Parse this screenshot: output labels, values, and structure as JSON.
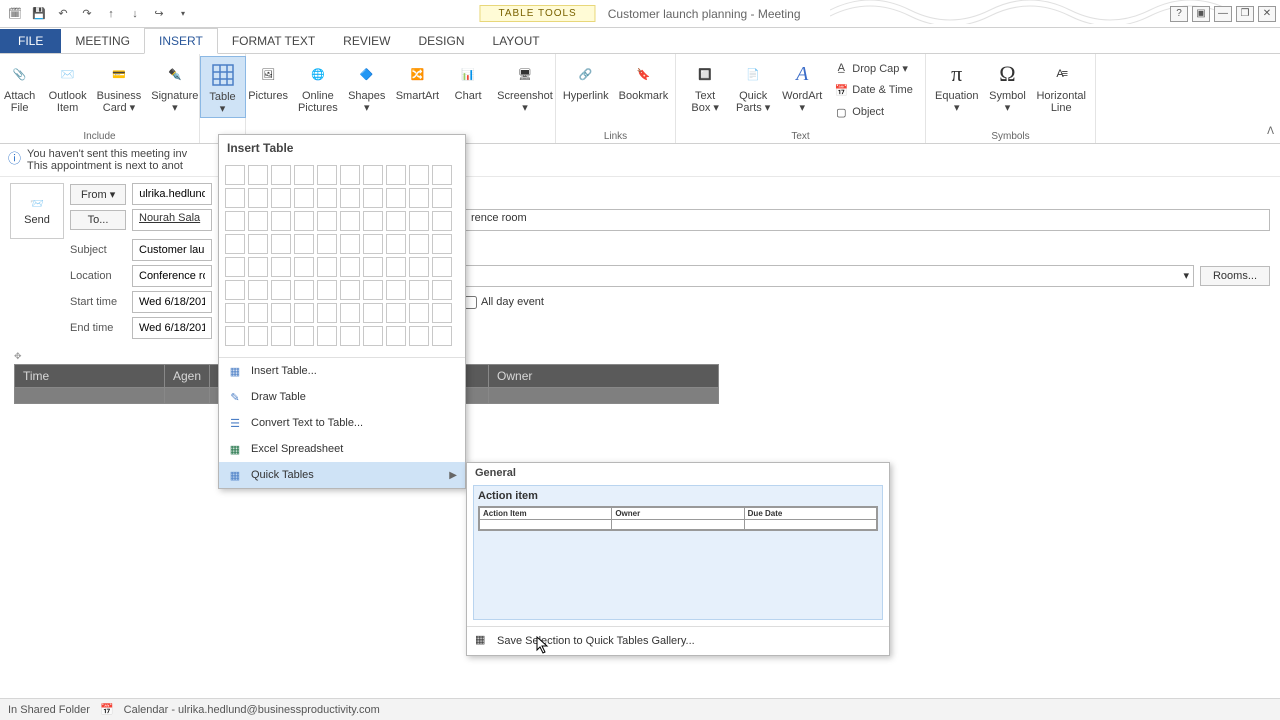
{
  "window": {
    "title": "Customer launch planning - Meeting",
    "table_tools": "TABLE TOOLS"
  },
  "qat": [
    "calendar-icon",
    "save-icon",
    "undo-icon",
    "redo-icon",
    "up-icon",
    "down-icon",
    "forward-icon"
  ],
  "win_controls": {
    "help": "?",
    "full": "▣",
    "min": "—",
    "restore": "❐",
    "close": "✕"
  },
  "tabs": {
    "file": "FILE",
    "list": [
      "MEETING",
      "INSERT",
      "FORMAT TEXT",
      "REVIEW",
      "DESIGN",
      "LAYOUT"
    ],
    "active": "INSERT"
  },
  "ribbon": {
    "groups": {
      "include": {
        "label": "Include",
        "items": [
          "Attach\nFile",
          "Outlook\nItem",
          "Business\nCard ▾",
          "Signature\n▾"
        ]
      },
      "tables": {
        "items": [
          "Table\n▾"
        ]
      },
      "illustrations": {
        "items": [
          "Pictures",
          "Online\nPictures",
          "Shapes\n▾",
          "SmartArt",
          "Chart",
          "Screenshot\n▾"
        ]
      },
      "links": {
        "label": "Links",
        "items": [
          "Hyperlink",
          "Bookmark"
        ]
      },
      "text": {
        "label": "Text",
        "items": [
          "Text\nBox ▾",
          "Quick\nParts ▾",
          "WordArt\n▾"
        ],
        "small": [
          "Drop Cap ▾",
          "Date & Time",
          "Object"
        ]
      },
      "symbols": {
        "label": "Symbols",
        "items": [
          "Equation\n▾",
          "Symbol\n▾",
          "Horizontal\nLine"
        ]
      }
    }
  },
  "info_bar": {
    "line1": "You haven't sent this meeting inv",
    "line2": "This appointment is next to anot"
  },
  "form": {
    "send": "Send",
    "from_label": "From ▾",
    "from_value": "ulrika.hedlund@",
    "to_label": "To...",
    "to_value": "Nourah Sala",
    "to_extra": "rence room",
    "subject_label": "Subject",
    "subject_value": "Customer laun",
    "location_label": "Location",
    "location_value": "Conference ro",
    "rooms": "Rooms...",
    "start_label": "Start time",
    "start_value": "Wed 6/18/201",
    "end_label": "End time",
    "end_value": "Wed 6/18/201",
    "all_day": "All day event"
  },
  "preview_headers": [
    "Time",
    "Agen",
    "Owner"
  ],
  "table_panel": {
    "title": "Insert Table",
    "items": [
      "Insert Table...",
      "Draw Table",
      "Convert Text to Table...",
      "Excel Spreadsheet",
      "Quick Tables"
    ]
  },
  "quick_tables": {
    "section": "General",
    "item_title": "Action item",
    "preview_headers": [
      "Action Item",
      "Owner",
      "Due Date"
    ],
    "footer": "Save Selection to Quick Tables Gallery..."
  },
  "status": {
    "folder": "In Shared Folder",
    "calendar": "Calendar - ulrika.hedlund@businessproductivity.com"
  }
}
